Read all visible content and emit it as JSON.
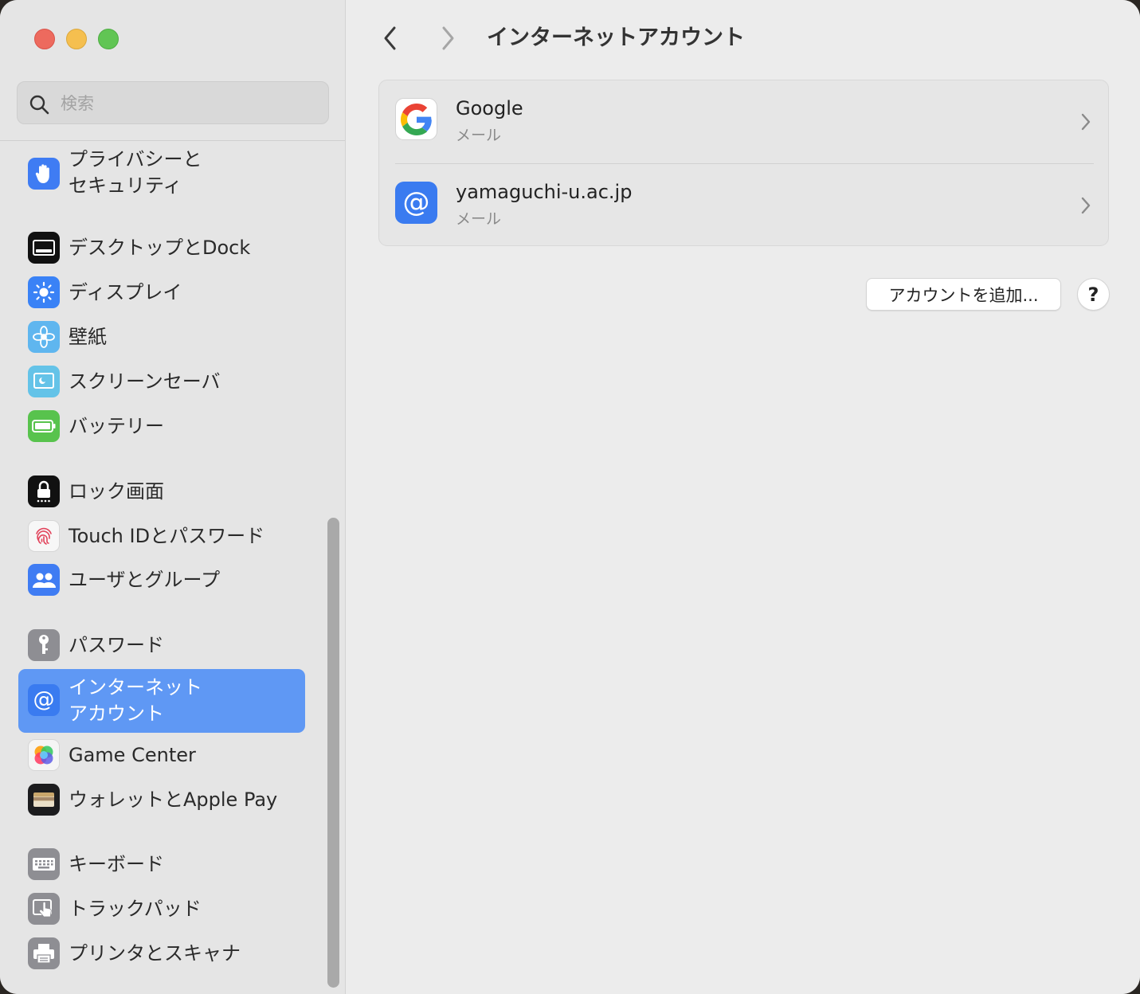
{
  "window": {
    "traffic_lights": {
      "close": "#ed6a5e",
      "minimize": "#f5bf4f",
      "maximize": "#61c554"
    }
  },
  "search": {
    "placeholder": "検索",
    "icon": "magnifier-icon"
  },
  "sidebar": {
    "selected_color": "#5f98f4",
    "items": [
      {
        "label": "プライバシーと\nセキュリティ",
        "icon": "hand-icon"
      },
      {
        "label": "デスクトップとDock",
        "icon": "dock-icon"
      },
      {
        "label": "ディスプレイ",
        "icon": "sun-icon"
      },
      {
        "label": "壁紙",
        "icon": "flower-icon"
      },
      {
        "label": "スクリーンセーバ",
        "icon": "screensaver-icon"
      },
      {
        "label": "バッテリー",
        "icon": "battery-icon"
      },
      {
        "label": "ロック画面",
        "icon": "lock-icon"
      },
      {
        "label": "Touch IDとパスワード",
        "icon": "fingerprint-icon"
      },
      {
        "label": "ユーザとグループ",
        "icon": "users-icon"
      },
      {
        "label": "パスワード",
        "icon": "key-icon"
      },
      {
        "label": "インターネット\nアカウント",
        "icon": "at-icon",
        "selected": true
      },
      {
        "label": "Game Center",
        "icon": "game-center-icon"
      },
      {
        "label": "ウォレットとApple Pay",
        "icon": "wallet-icon"
      },
      {
        "label": "キーボード",
        "icon": "keyboard-icon"
      },
      {
        "label": "トラックパッド",
        "icon": "trackpad-icon"
      },
      {
        "label": "プリンタとスキャナ",
        "icon": "printer-icon"
      }
    ]
  },
  "toolbar": {
    "title": "インターネットアカウント",
    "back_icon": "chevron-left-icon",
    "forward_icon": "chevron-right-icon"
  },
  "accounts": [
    {
      "name": "Google",
      "service": "メール",
      "icon": "google-icon"
    },
    {
      "name": "yamaguchi-u.ac.jp",
      "service": "メール",
      "icon": "at-icon"
    }
  ],
  "actions": {
    "add_account": "アカウントを追加...",
    "help": "?"
  }
}
